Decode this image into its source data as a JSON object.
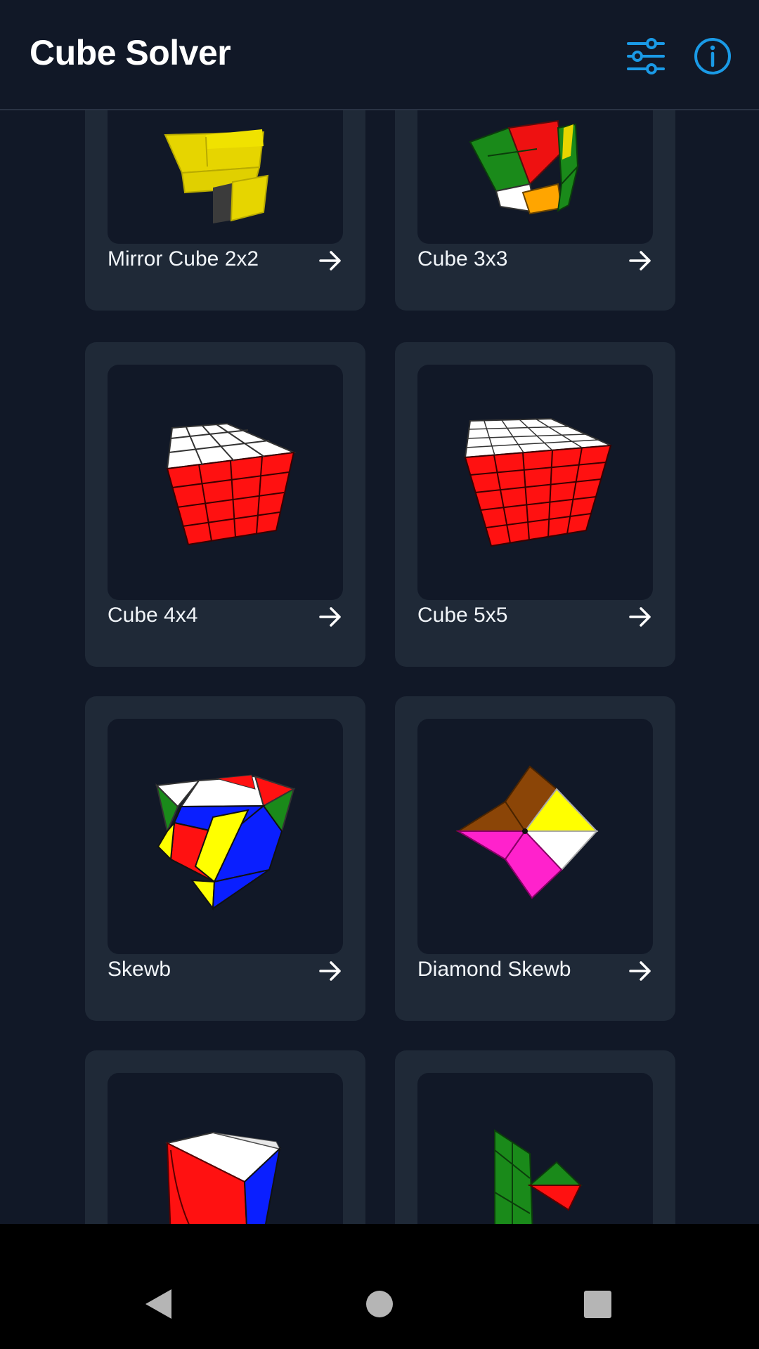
{
  "app": {
    "title": "Cube Solver",
    "accent_color": "#1a9ae6",
    "actions": [
      {
        "name": "filter",
        "icon": "sliders-icon"
      },
      {
        "name": "info",
        "icon": "info-icon"
      }
    ]
  },
  "puzzles": [
    {
      "label": "Mirror Cube 2x2",
      "icon": "mirror-cube-2x2-image"
    },
    {
      "label": "Cube 3x3",
      "icon": "cube-3x3-image"
    },
    {
      "label": "Cube 4x4",
      "icon": "cube-4x4-image"
    },
    {
      "label": "Cube 5x5",
      "icon": "cube-5x5-image"
    },
    {
      "label": "Skewb",
      "icon": "skewb-image"
    },
    {
      "label": "Diamond Skewb",
      "icon": "diamond-skewb-image"
    },
    {
      "label": "",
      "icon": "ivy-cube-image"
    },
    {
      "label": "",
      "icon": "pyraminx-image"
    }
  ],
  "navigation": {
    "back": "back-icon",
    "home": "home-icon",
    "recents": "recents-icon"
  }
}
